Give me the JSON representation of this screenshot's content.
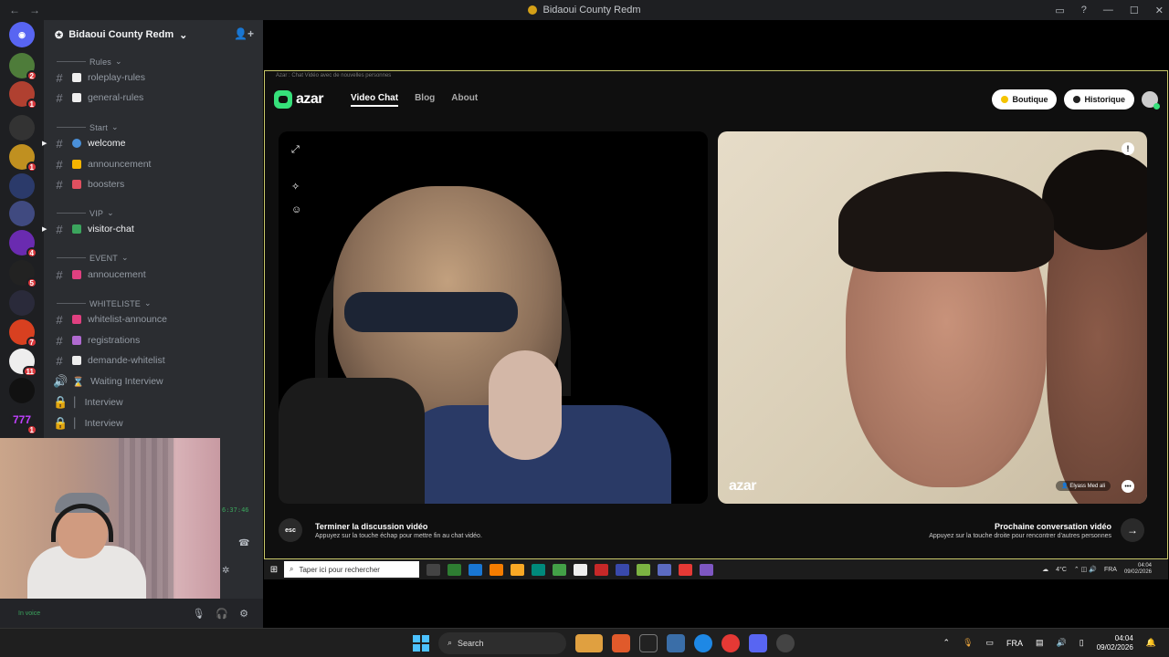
{
  "titlebar": {
    "title": "Bidaoui County Redm"
  },
  "rail": {
    "servers": [
      {
        "badge": ""
      },
      {
        "badge": "2"
      },
      {
        "badge": "1"
      },
      {
        "badge": ""
      },
      {
        "badge": "1"
      },
      {
        "badge": ""
      },
      {
        "badge": ""
      },
      {
        "badge": "4"
      },
      {
        "badge": "5"
      },
      {
        "badge": ""
      },
      {
        "badge": "7"
      },
      {
        "badge": "11"
      },
      {
        "badge": ""
      },
      {
        "badge": "1"
      }
    ],
    "text_tile": "777"
  },
  "sidebar": {
    "server_name": "Bidaoui County Redm",
    "categories": [
      "Rules",
      "Start",
      "VIP",
      "EVENT",
      "WHITELISTE"
    ],
    "channels": [
      {
        "label": "roleplay-rules"
      },
      {
        "label": "general-rules"
      },
      {
        "label": "welcome"
      },
      {
        "label": "announcement"
      },
      {
        "label": "boosters"
      },
      {
        "label": "visitor-chat"
      },
      {
        "label": "annoucement"
      },
      {
        "label": "whitelist-announce"
      },
      {
        "label": "registrations"
      },
      {
        "label": "demande-whitelist"
      },
      {
        "label": "Waiting Interview"
      },
      {
        "label": "Interview"
      },
      {
        "label": "Interview"
      }
    ]
  },
  "webcam": {
    "timer": "6:37:46"
  },
  "userbar": {
    "status": "In voice"
  },
  "azar": {
    "window_caption": "Azar : Chat Vidéo avec de nouvelles personnes",
    "nav": {
      "video_chat": "Video Chat",
      "blog": "Blog",
      "about": "About"
    },
    "buttons": {
      "boutique": "Boutique",
      "historique": "Historique"
    },
    "right_video": {
      "watermark": "azar",
      "user_tag": "Elyass Med ali"
    },
    "bottom": {
      "esc_label": "esc",
      "end_title": "Terminer la discussion vidéo",
      "end_sub": "Appuyez sur la touche échap pour mettre fin au chat vidéo.",
      "next_title": "Prochaine conversation vidéo",
      "next_sub": "Appuyez sur la touche droite pour rencontrer d'autres personnes"
    }
  },
  "inner_taskbar": {
    "search_placeholder": "Taper ici pour rechercher",
    "weather": "4°C",
    "lang": "FRA",
    "time": "04:04",
    "date": "09/02/2026"
  },
  "taskbar": {
    "search_label": "Search",
    "lang": "FRA",
    "time": "04:04",
    "date": "09/02/2026"
  },
  "colors": {
    "discord_bg": "#2b2d31",
    "azar_green": "#36e07a",
    "accent_yellow": "#f5c400"
  }
}
